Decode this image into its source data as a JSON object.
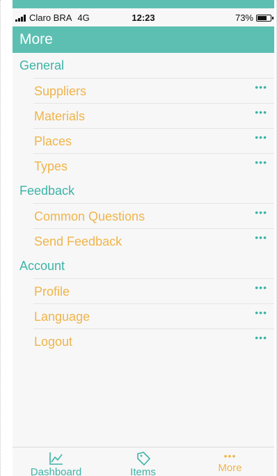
{
  "status_bar": {
    "carrier": "Claro BRA",
    "network": "4G",
    "time": "12:23",
    "battery": "73%",
    "battery_level": 0.73
  },
  "nav": {
    "title": "More"
  },
  "sections": [
    {
      "header": "General",
      "items": [
        {
          "label": "Suppliers",
          "more": "•••"
        },
        {
          "label": "Materials",
          "more": "•••"
        },
        {
          "label": "Places",
          "more": "•••"
        },
        {
          "label": "Types",
          "more": "•••"
        }
      ]
    },
    {
      "header": "Feedback",
      "items": [
        {
          "label": "Common Questions",
          "more": "•••"
        },
        {
          "label": "Send Feedback",
          "more": "•••"
        }
      ]
    },
    {
      "header": "Account",
      "items": [
        {
          "label": "Profile",
          "more": "•••"
        },
        {
          "label": "Language",
          "more": "•••"
        },
        {
          "label": "Logout",
          "more": "•••"
        }
      ]
    }
  ],
  "tab_bar": {
    "tabs": [
      {
        "label": "Dashboard",
        "icon": "chart-line-icon",
        "active": false
      },
      {
        "label": "Items",
        "icon": "tag-icon",
        "active": false
      },
      {
        "label": "More",
        "icon": "more-dots-icon",
        "active": true
      }
    ],
    "more_dots": "•••"
  },
  "colors": {
    "accent_teal": "#5cbfb2",
    "section_teal": "#3db3a7",
    "item_orange": "#f0b44a"
  }
}
